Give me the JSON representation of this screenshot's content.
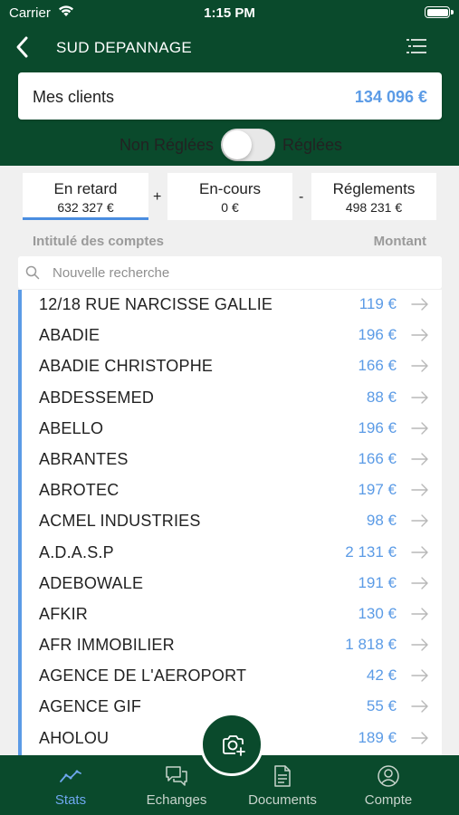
{
  "status_bar": {
    "carrier": "Carrier",
    "time": "1:15 PM"
  },
  "nav": {
    "title": "SUD DEPANNAGE"
  },
  "summary": {
    "label": "Mes clients",
    "amount": "134 096 €"
  },
  "toggle": {
    "left_label": "Non Réglées",
    "right_label": "Réglées",
    "is_on": false
  },
  "tabs": [
    {
      "label": "En retard",
      "value": "632 327 €",
      "active": true
    },
    {
      "label": "En-cours",
      "value": "0 €",
      "active": false
    },
    {
      "label": "Réglements",
      "value": "498 231 €",
      "active": false
    }
  ],
  "tab_operators": [
    "+",
    "-"
  ],
  "list_headers": {
    "name": "Intitulé des comptes",
    "amount": "Montant"
  },
  "search": {
    "placeholder": "Nouvelle recherche",
    "value": ""
  },
  "clients": [
    {
      "name": "12/18 RUE NARCISSE GALLIE",
      "amount": "119 €"
    },
    {
      "name": "ABADIE",
      "amount": "196 €"
    },
    {
      "name": "ABADIE CHRISTOPHE",
      "amount": "166 €"
    },
    {
      "name": "ABDESSEMED",
      "amount": "88 €"
    },
    {
      "name": "ABELLO",
      "amount": "196 €"
    },
    {
      "name": "ABRANTES",
      "amount": "166 €"
    },
    {
      "name": "ABROTEC",
      "amount": "197 €"
    },
    {
      "name": "ACMEL INDUSTRIES",
      "amount": "98 €"
    },
    {
      "name": "A.D.A.S.P",
      "amount": "2 131 €"
    },
    {
      "name": "ADEBOWALE",
      "amount": "191 €"
    },
    {
      "name": "AFKIR",
      "amount": "130 €"
    },
    {
      "name": "AFR IMMOBILIER",
      "amount": "1 818 €"
    },
    {
      "name": "AGENCE DE L'AEROPORT",
      "amount": "42 €"
    },
    {
      "name": "AGENCE GIF",
      "amount": "55 €"
    },
    {
      "name": "AHOLOU",
      "amount": "189 €"
    }
  ],
  "tabbar": [
    {
      "label": "Stats",
      "icon": "stats-icon",
      "active": true
    },
    {
      "label": "Echanges",
      "icon": "chat-icon",
      "active": false
    },
    {
      "label": "Documents",
      "icon": "document-icon",
      "active": false
    },
    {
      "label": "Compte",
      "icon": "account-icon",
      "active": false
    }
  ],
  "fab": {
    "icon": "camera-add-icon"
  },
  "colors": {
    "brand_green": "#0a4a2c",
    "accent_blue": "#5b9be6",
    "background": "#f0f0f0"
  }
}
